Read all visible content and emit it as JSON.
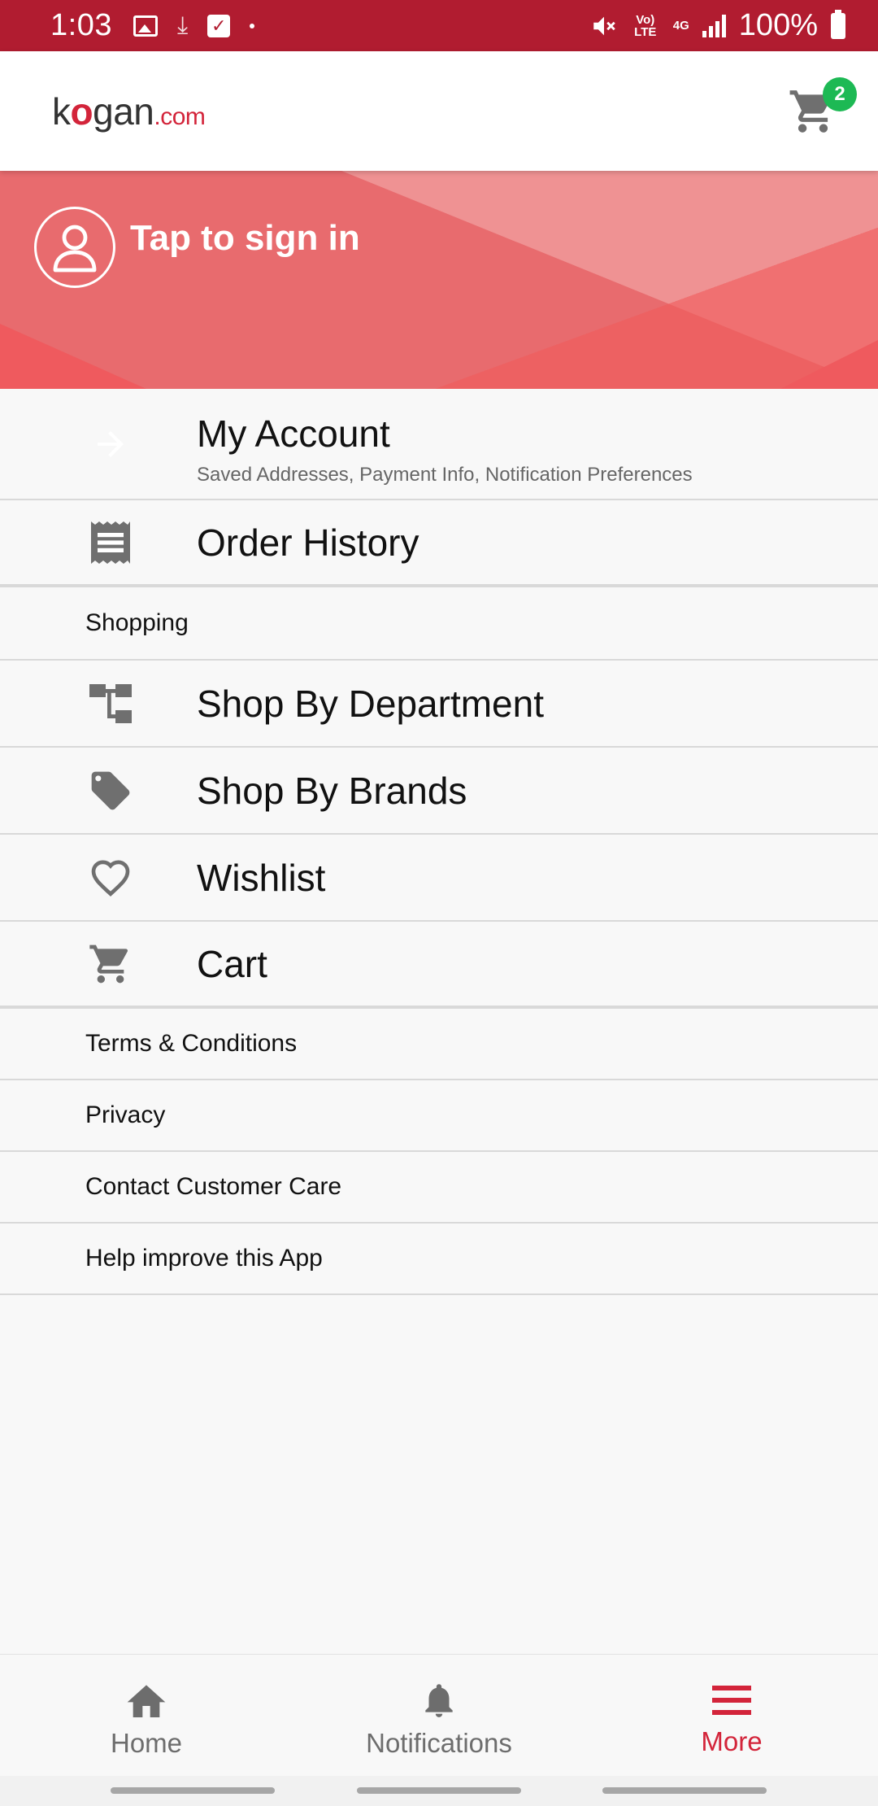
{
  "status_bar": {
    "time": "1:03",
    "network_volte": "Vo) LTE",
    "network_4g": "4G",
    "battery": "100%"
  },
  "app_bar": {
    "logo_text_k": "k",
    "logo_text_o": "o",
    "logo_text_rest": "gan",
    "logo_text_tld": ".com",
    "cart_count": "2",
    "accent_color": "#d3243a",
    "badge_color": "#1db954"
  },
  "banner": {
    "signin_text": "Tap to sign in"
  },
  "menu": {
    "my_account": {
      "label": "My Account",
      "sublabel": "Saved Addresses, Payment Info, Notification Preferences",
      "icon": "arrow-right-icon"
    },
    "order_history": {
      "label": "Order History",
      "icon": "receipt-icon"
    },
    "section_shopping": "Shopping",
    "shop_by_department": {
      "label": "Shop By Department",
      "icon": "hierarchy-icon"
    },
    "shop_by_brands": {
      "label": "Shop By Brands",
      "icon": "tag-icon"
    },
    "wishlist": {
      "label": "Wishlist",
      "icon": "heart-icon"
    },
    "cart": {
      "label": "Cart",
      "icon": "cart-icon"
    },
    "terms": "Terms & Conditions",
    "privacy": "Privacy",
    "contact": "Contact Customer Care",
    "help": "Help improve this App"
  },
  "bottom_nav": {
    "home": "Home",
    "notifications": "Notifications",
    "more": "More",
    "active": "More"
  }
}
